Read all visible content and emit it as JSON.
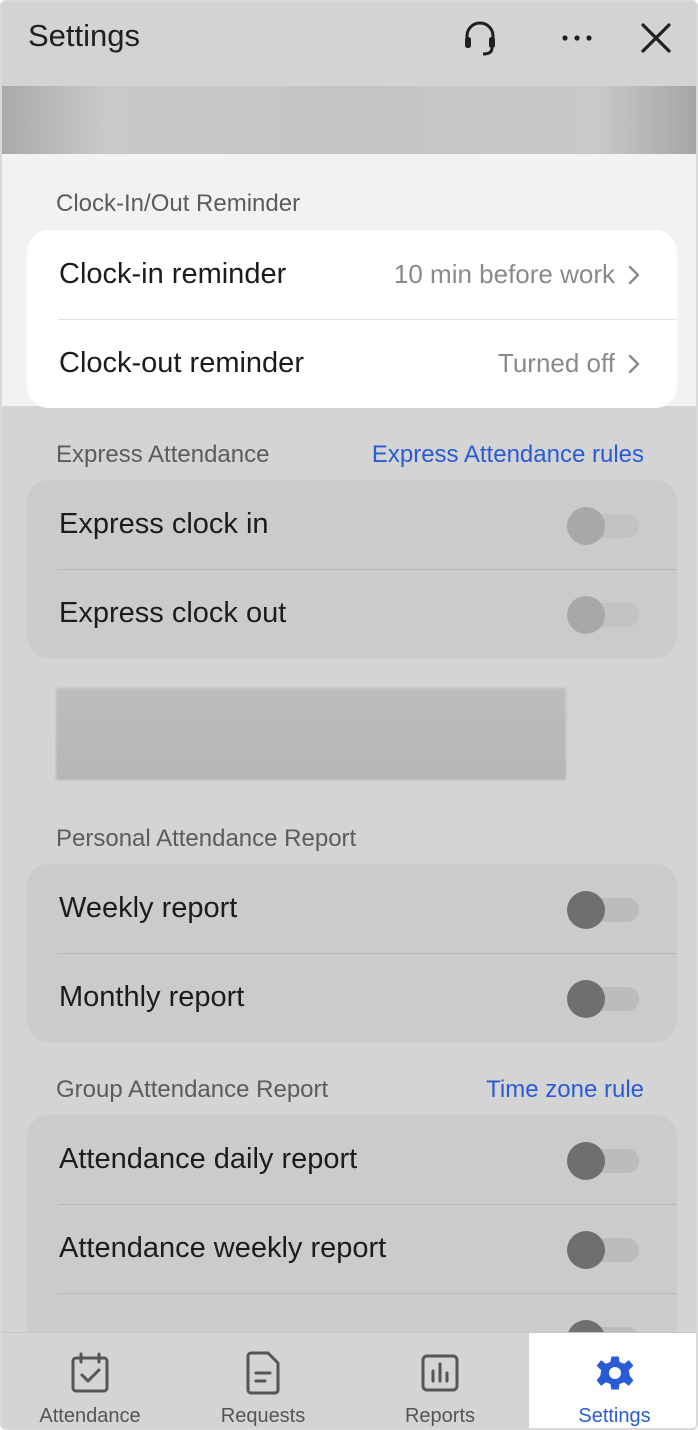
{
  "header": {
    "title": "Settings"
  },
  "sections": {
    "reminder": {
      "title": "Clock-In/Out Reminder",
      "rows": [
        {
          "label": "Clock-in reminder",
          "value": "10 min before work"
        },
        {
          "label": "Clock-out reminder",
          "value": "Turned off"
        }
      ]
    },
    "express": {
      "title": "Express Attendance",
      "link": "Express Attendance rules",
      "rows": [
        {
          "label": "Express clock in",
          "enabled": false
        },
        {
          "label": "Express clock out",
          "enabled": false
        }
      ]
    },
    "personal": {
      "title": "Personal Attendance Report",
      "rows": [
        {
          "label": "Weekly report",
          "enabled": false
        },
        {
          "label": "Monthly report",
          "enabled": false
        }
      ]
    },
    "group": {
      "title": "Group Attendance Report",
      "link": "Time zone rule",
      "rows": [
        {
          "label": "Attendance daily report",
          "enabled": false
        },
        {
          "label": "Attendance weekly report",
          "enabled": false
        }
      ]
    }
  },
  "tabbar": {
    "tabs": [
      {
        "label": "Attendance",
        "icon": "calendar-check-icon"
      },
      {
        "label": "Requests",
        "icon": "document-icon"
      },
      {
        "label": "Reports",
        "icon": "bar-chart-icon"
      },
      {
        "label": "Settings",
        "icon": "gear-icon",
        "active": true
      }
    ]
  },
  "colors": {
    "accent": "#2a5bd7",
    "overlay": "#d4d4d4"
  }
}
